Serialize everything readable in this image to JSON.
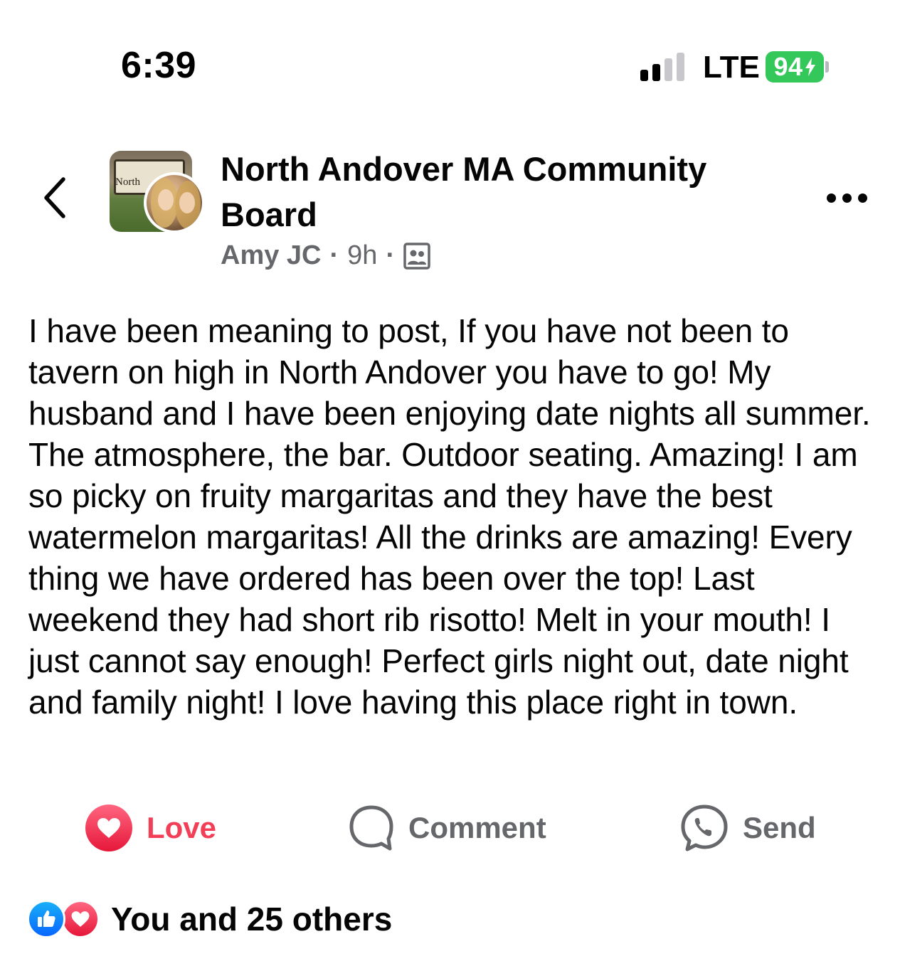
{
  "status_bar": {
    "time": "6:39",
    "network": "LTE",
    "battery": "94",
    "signal_bars_filled": 2,
    "signal_bars_total": 4,
    "battery_color": "#34c759"
  },
  "header": {
    "back_icon": "chevron-left-icon",
    "group_name": "North Andover MA Community Board",
    "group_photo_sign_text": "North",
    "author": "Amy JC",
    "time": "9h",
    "audience_icon": "group-members-icon",
    "more_icon": "more-horizontal-icon"
  },
  "post": {
    "text": "I have been meaning to post, If you have not been to tavern on high in North Andover you have to go! My husband and I have been enjoying date nights all summer. The atmosphere, the bar. Outdoor seating. Amazing! I am so picky on fruity margaritas and they have the best watermelon margaritas! All the drinks are amazing! Every thing we have ordered has been over the top! Last weekend they had short rib risotto! Melt in your mouth! I just cannot say enough! Perfect girls night out, date night and family night! I love having this place right in town."
  },
  "actions": {
    "love": {
      "label": "Love",
      "icon": "heart-icon",
      "color": "#f33e58"
    },
    "comment": {
      "label": "Comment",
      "icon": "comment-bubble-icon"
    },
    "send": {
      "label": "Send",
      "icon": "messenger-send-icon"
    }
  },
  "reactions": {
    "icons": [
      "like-icon",
      "heart-icon"
    ],
    "summary": "You and 25 others"
  },
  "colors": {
    "text_primary": "#050505",
    "text_secondary": "#65676b",
    "like_blue": "#0866ff"
  }
}
